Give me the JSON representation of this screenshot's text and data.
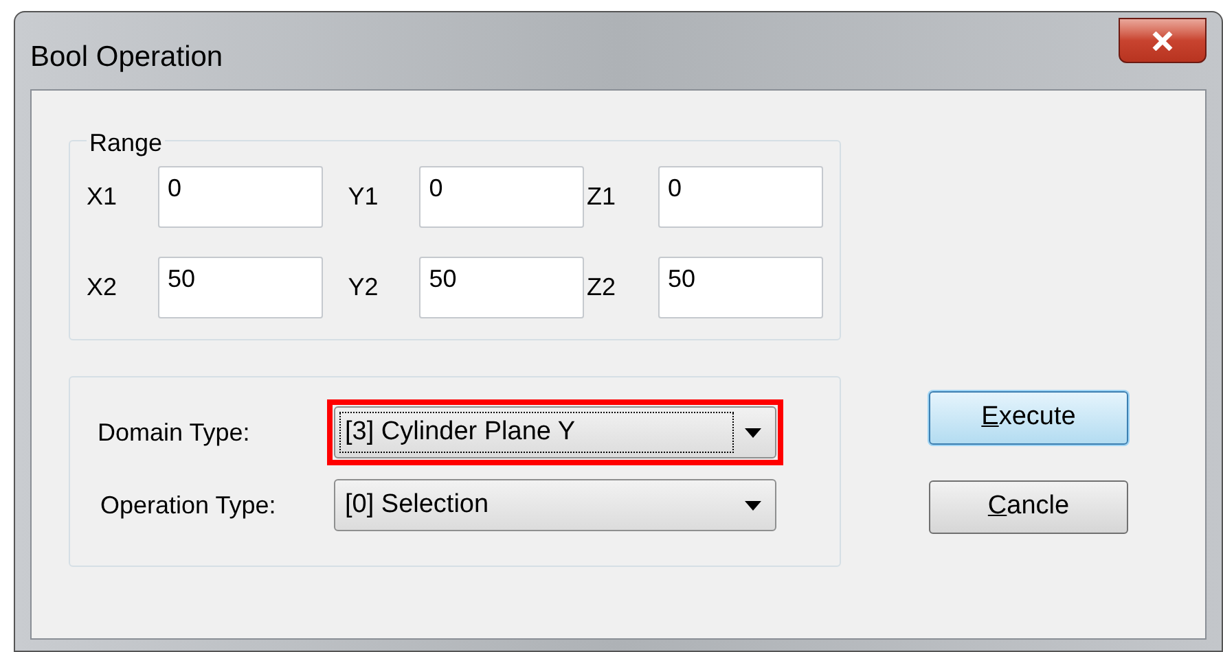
{
  "window": {
    "title": "Bool Operation"
  },
  "range": {
    "title": "Range",
    "fields": [
      {
        "label": "X1",
        "value": "0"
      },
      {
        "label": "Y1",
        "value": "0"
      },
      {
        "label": "Z1",
        "value": "0"
      },
      {
        "label": "X2",
        "value": "50"
      },
      {
        "label": "Y2",
        "value": "50"
      },
      {
        "label": "Z2",
        "value": "50"
      }
    ]
  },
  "combos": [
    {
      "label": "Domain Type:",
      "value": "[3] Cylinder Plane Y",
      "focused": true,
      "highlighted": true
    },
    {
      "label": "Operation Type:",
      "value": "[0] Selection",
      "focused": false,
      "highlighted": false
    }
  ],
  "buttons": [
    {
      "label": "Execute",
      "default": true
    },
    {
      "label": "Cancle",
      "default": false
    }
  ]
}
